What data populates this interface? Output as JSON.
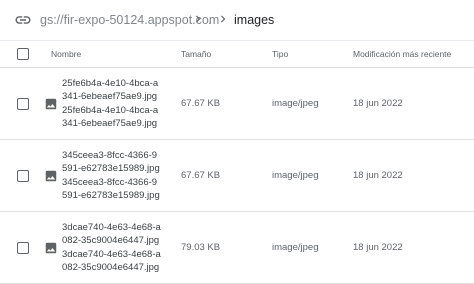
{
  "path": {
    "bucket": "gs://fir-expo-50124.appspot.com",
    "hidden_segment": ".",
    "current_folder": "images"
  },
  "table": {
    "headers": {
      "name": "Nombre",
      "size": "Tamaño",
      "type": "Tipo",
      "modified": "Modificación más reciente"
    },
    "rows": [
      {
        "name": "25fe6b4a-4e10-4bca-a341-6ebeaef75ae9.jpg25fe6b4a-4e10-4bca-a341-6ebeaef75ae9.jpg",
        "size": "67.67 KB",
        "type": "image/jpeg",
        "modified": "18 jun 2022"
      },
      {
        "name": "345ceea3-8fcc-4366-9591-e62783e15989.jpg345ceea3-8fcc-4366-9591-e62783e15989.jpg",
        "size": "67.67 KB",
        "type": "image/jpeg",
        "modified": "18 jun 2022"
      },
      {
        "name": "3dcae740-4e63-4e68-a082-35c9004e6447.jpg3dcae740-4e63-4e68-a082-35c9004e6447.jpg",
        "size": "79.03 KB",
        "type": "image/jpeg",
        "modified": "18 jun 2022"
      }
    ]
  },
  "icons": {
    "path": "link-icon",
    "separator": "chevron-right-icon",
    "file": "image-icon"
  }
}
